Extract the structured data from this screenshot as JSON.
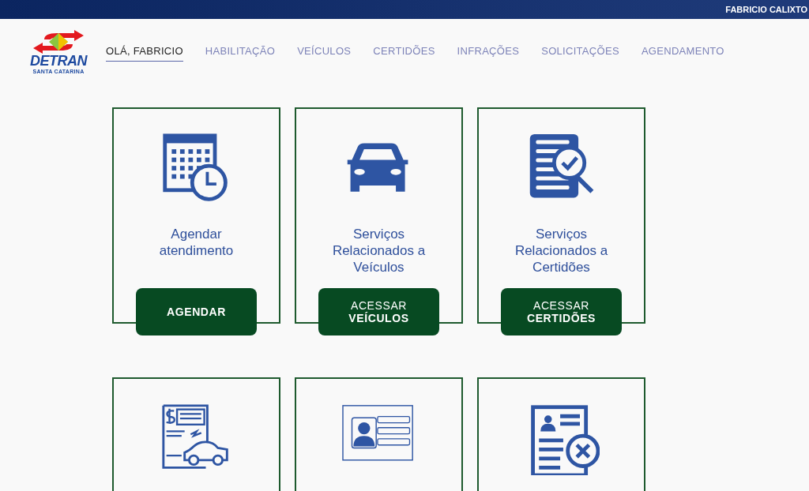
{
  "top_bar": {
    "user_name": "FABRICIO CALIXTO"
  },
  "logo": {
    "name": "DETRAN",
    "subtitle": "SANTA CATARINA"
  },
  "nav": [
    {
      "label": "OLÁ, FABRICIO",
      "selected": true
    },
    {
      "label": "HABILITAÇÃO",
      "selected": false
    },
    {
      "label": "VEÍCULOS",
      "selected": false
    },
    {
      "label": "CERTIDÕES",
      "selected": false
    },
    {
      "label": "INFRAÇÕES",
      "selected": false
    },
    {
      "label": "SOLICITAÇÕES",
      "selected": false
    },
    {
      "label": "AGENDAMENTO",
      "selected": false
    }
  ],
  "cards": [
    {
      "kind": "full",
      "title": "Agendar atendimento",
      "button": [
        "AGENDAR"
      ]
    },
    {
      "kind": "full",
      "title": "Serviços Relacionados a Veículos",
      "button": [
        "ACESSAR",
        "VEÍCULOS"
      ]
    },
    {
      "kind": "full",
      "title": "Serviços Relacionados a Certidões",
      "button": [
        "ACESSAR",
        "CERTIDÕES"
      ]
    },
    {
      "kind": "cut"
    },
    {
      "kind": "cut"
    },
    {
      "kind": "cut"
    }
  ]
}
